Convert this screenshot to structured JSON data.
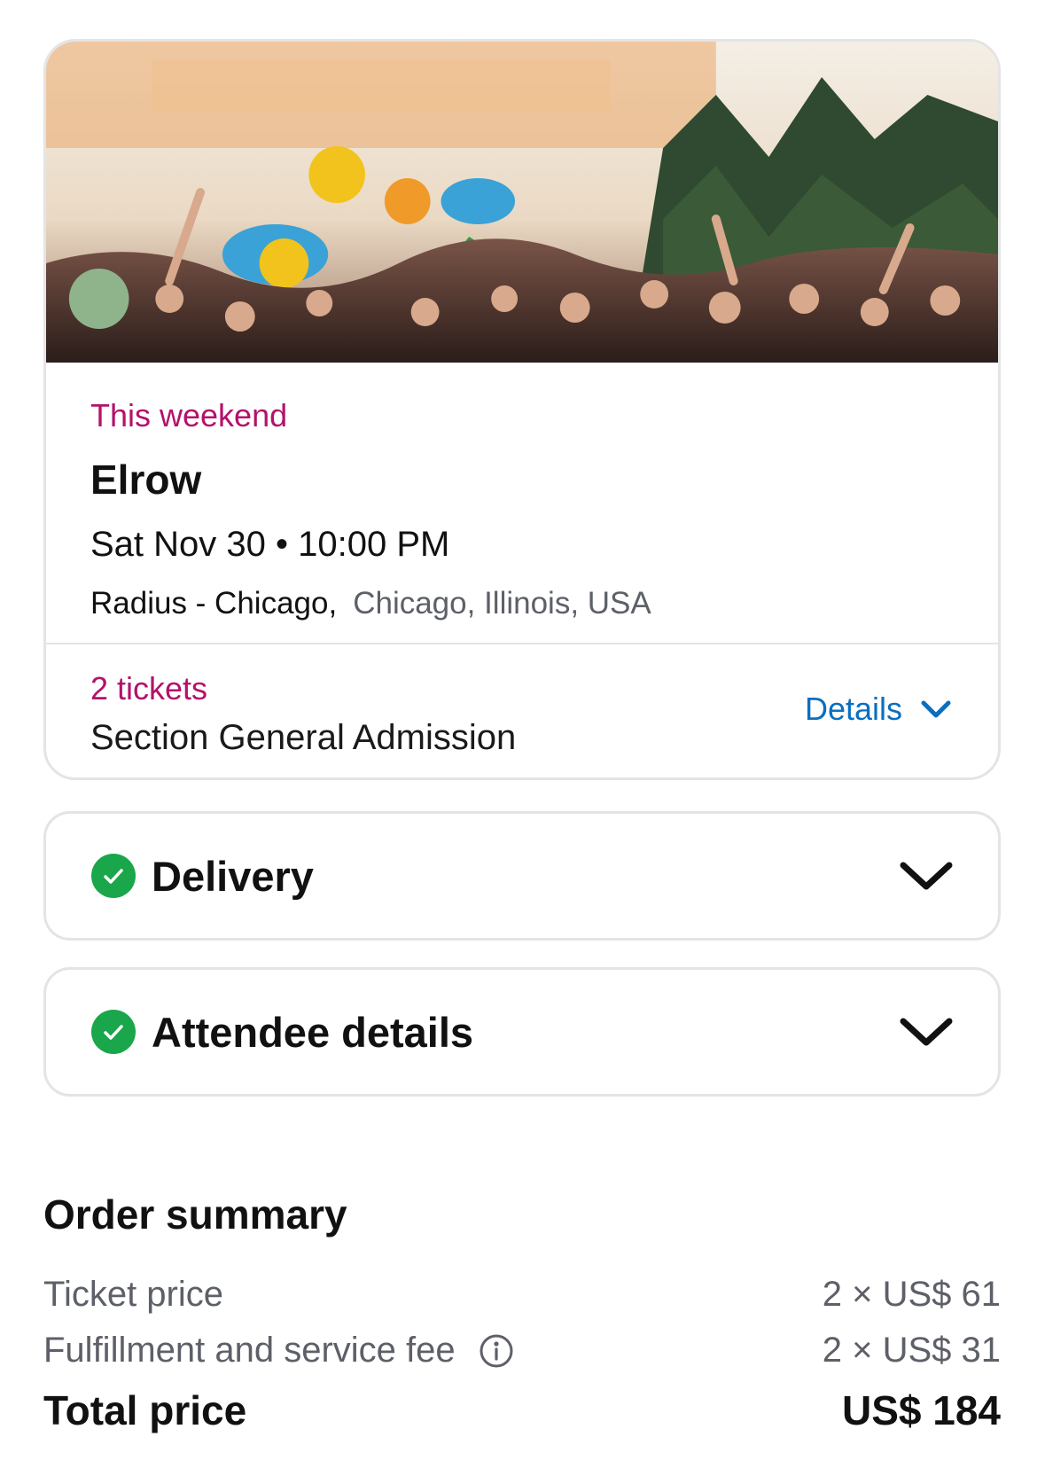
{
  "event": {
    "badge": "This weekend",
    "title": "Elrow",
    "datetime": "Sat Nov 30 • 10:00 PM",
    "venue": "Radius - Chicago,",
    "city": "Chicago, Illinois, USA",
    "ticket_count": "2 tickets",
    "section": "Section General Admission",
    "details_label": "Details"
  },
  "panels": [
    {
      "label": "Delivery",
      "status": "complete"
    },
    {
      "label": "Attendee details",
      "status": "complete"
    }
  ],
  "summary": {
    "title": "Order summary",
    "ticket_price_label": "Ticket price",
    "ticket_price_value": "2 × US$ 61",
    "fee_label": "Fulfillment and service fee",
    "fee_value": "2 × US$ 31",
    "total_label": "Total price",
    "total_value": "US$ 184"
  },
  "colors": {
    "accent_pink": "#b3126b",
    "link_blue": "#0a6fbf",
    "success_green": "#1aa64b"
  }
}
